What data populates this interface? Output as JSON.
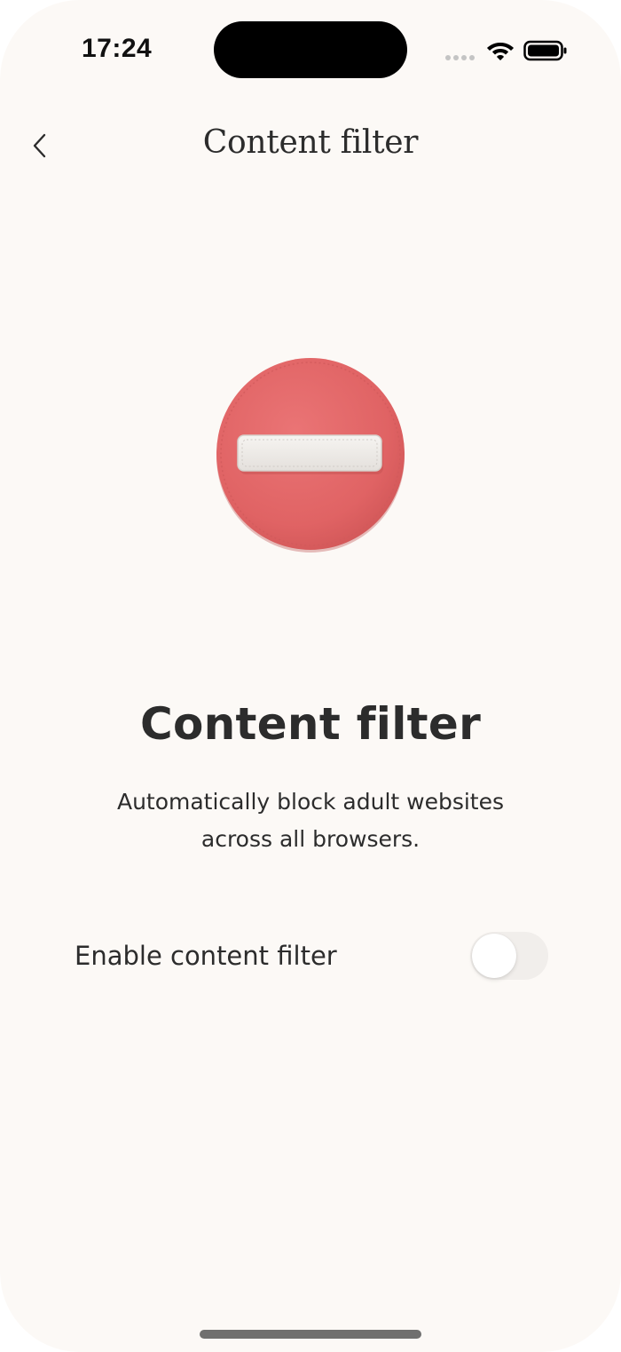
{
  "status_bar": {
    "time": "17:24"
  },
  "nav": {
    "title": "Content filter",
    "back_icon": "chevron-left-icon"
  },
  "illustration": {
    "icon": "no-entry-icon",
    "color": "#e56767"
  },
  "main": {
    "heading": "Content filter",
    "description": "Automatically block adult websites across all browsers."
  },
  "setting": {
    "label": "Enable content filter",
    "enabled": false
  },
  "colors": {
    "background": "#fcf9f6",
    "text": "#2c2c2c",
    "accent": "#e56767"
  }
}
